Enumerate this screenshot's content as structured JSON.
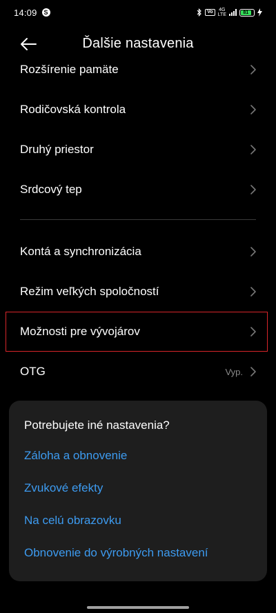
{
  "status_bar": {
    "time": "14:09",
    "app_badge": "S",
    "vo_label": "Vo",
    "net_top": "4G",
    "net_bottom": "LTE",
    "battery": "81",
    "battery_color": "#35e05a"
  },
  "header": {
    "title": "Ďalšie nastavenia"
  },
  "list": {
    "items_top": [
      {
        "label": "Rozšírenie pamäte"
      },
      {
        "label": "Rodičovská kontrola"
      },
      {
        "label": "Druhý priestor"
      },
      {
        "label": "Srdcový tep"
      }
    ],
    "items_bottom": [
      {
        "label": "Kontá a synchronizácia"
      },
      {
        "label": "Režim veľkých spoločností"
      },
      {
        "label": "Možnosti pre vývojárov"
      },
      {
        "label": "OTG",
        "value": "Vyp."
      }
    ]
  },
  "card": {
    "title": "Potrebujete iné nastavenia?",
    "links": [
      "Záloha a obnovenie",
      "Zvukové efekty",
      "Na celú obrazovku",
      "Obnovenie do výrobných nastavení"
    ],
    "link_color": "#3d9bf0"
  },
  "highlight_color": "#d9262a"
}
